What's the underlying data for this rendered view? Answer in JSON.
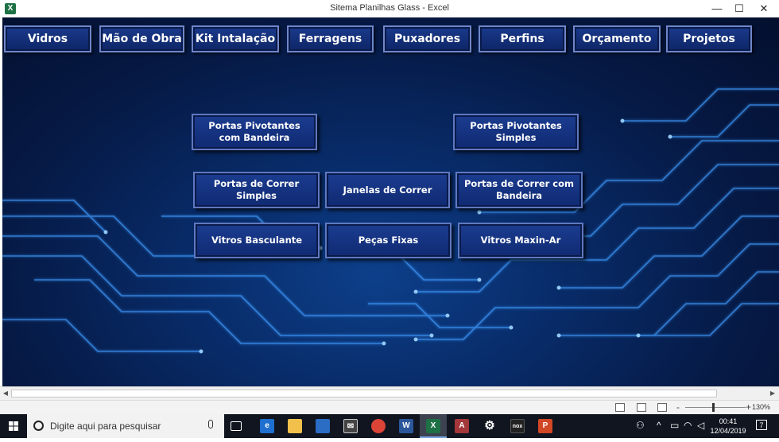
{
  "window": {
    "title": "Sitema Planilhas Glass - Excel",
    "app_icon": "X",
    "minimize_glyph": "—",
    "maximize_glyph": "☐",
    "close_glyph": "✕"
  },
  "nav": {
    "items": [
      "Vidros",
      "Mão de Obra",
      "Kit Intalação",
      "Ferragens",
      "Puxadores",
      "Perfins",
      "Orçamento",
      "Projetos"
    ]
  },
  "projects": {
    "portas_pivotantes_bandeira": "Portas Pivotantes com Bandeira",
    "portas_pivotantes_simples": "Portas Pivotantes Simples",
    "portas_correr_simples": "Portas de Correr Simples",
    "janelas_correr": "Janelas de Correr",
    "portas_correr_bandeira": "Portas de Correr com Bandeira",
    "vitros_basculante": "Vitros Basculante",
    "pecas_fixas": "Peças Fixas",
    "vitros_maxin_ar": "Vitros Maxin-Ar"
  },
  "statusbar": {
    "zoom": "130%",
    "zoom_minus": "-",
    "zoom_plus": "+"
  },
  "taskbar": {
    "search_placeholder": "Digite aqui para pesquisar",
    "time": "00:41",
    "date": "12/04/2019",
    "notification_count": "7",
    "apps": [
      "task-view",
      "edge",
      "file-explorer",
      "store",
      "mail",
      "chrome",
      "word",
      "excel",
      "access",
      "settings",
      "nox",
      "powerpoint"
    ]
  },
  "colors": {
    "background_deep": "#040f2e",
    "background_glow": "#0d3f8a",
    "button_fill": "#1a3a8c",
    "button_border": "#6f86c9",
    "circuit_line": "#4aa8ff",
    "taskbar": "#101520"
  }
}
